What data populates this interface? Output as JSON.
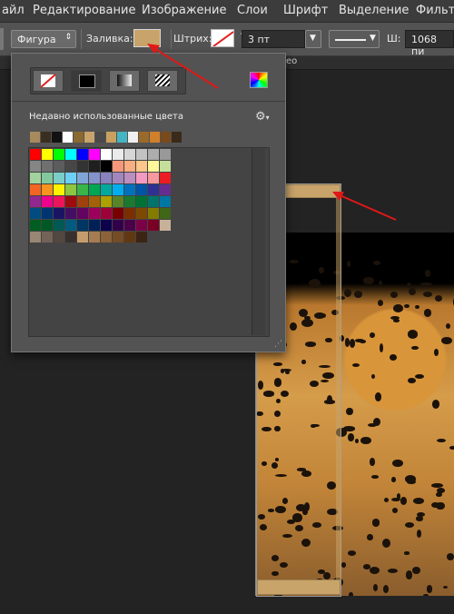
{
  "menubar": {
    "items": [
      "айл",
      "Редактирование",
      "Изображение",
      "Слои",
      "Шрифт",
      "Выделение",
      "Фильтр"
    ]
  },
  "options": {
    "shape_mode": "Фигура",
    "fill_label": "Заливка:",
    "stroke_label": "Штрих:",
    "stroke_width": "3 пт",
    "width_label": "Ш:",
    "width_value": "1068 пи",
    "fill_color": "#c8a46a"
  },
  "tab": {
    "label": "ео"
  },
  "picker": {
    "recent_title": "Недавно использованные цвета",
    "modes": [
      "no-fill",
      "solid",
      "gradient",
      "pattern"
    ],
    "recent_colors": [
      "#a88a5c",
      "#3a2e1e",
      "#111111",
      "#ffffff",
      "#8a6a30",
      "#c8a46a",
      "#4a4a4a",
      "#c8a060",
      "#43b5c2",
      "#f0f0f0",
      "#9a6a2a",
      "#d0802a",
      "#7a4a1a",
      "#3a2a1a"
    ],
    "swatches": [
      "#ff0000",
      "#ffff00",
      "#00ff00",
      "#00ffff",
      "#0000ff",
      "#ff00ff",
      "#ffffff",
      "#ebebeb",
      "#d6d6d6",
      "#c2c2c2",
      "#adadad",
      "#999999",
      "#858585",
      "#707070",
      "#5c5c5c",
      "#474747",
      "#333333",
      "#1f1f1f",
      "#000000",
      "#f7977a",
      "#f9ad81",
      "#fdc68a",
      "#fff79a",
      "#c4df9b",
      "#a2d39c",
      "#82ca9d",
      "#7bcdc8",
      "#6ecff6",
      "#7ea7d8",
      "#8493ca",
      "#8882be",
      "#a187be",
      "#bc8dbf",
      "#f49ac2",
      "#f6989d",
      "#ed1c24",
      "#f26522",
      "#f7941d",
      "#fff200",
      "#8dc63f",
      "#39b54a",
      "#00a651",
      "#00a99d",
      "#00aeef",
      "#0072bc",
      "#0054a6",
      "#2e3192",
      "#662d91",
      "#92278f",
      "#ec008c",
      "#ed145b",
      "#9e0b0f",
      "#a0410d",
      "#a36209",
      "#aba000",
      "#598527",
      "#1a7b30",
      "#007236",
      "#00746b",
      "#0076a3",
      "#004b80",
      "#003471",
      "#1b1464",
      "#440e62",
      "#630460",
      "#9e005d",
      "#9e0039",
      "#790000",
      "#7b2e00",
      "#7d4900",
      "#827b00",
      "#406618",
      "#005e20",
      "#005826",
      "#005952",
      "#005b7f",
      "#003663",
      "#002157",
      "#0d004c",
      "#32004b",
      "#4b0049",
      "#7b0046",
      "#7a0026",
      "#c7b299",
      "#998675",
      "#736357",
      "#534741",
      "#37302d",
      "#c69c6d",
      "#a67c52",
      "#8c6239",
      "#754c24",
      "#603913",
      "#3c2415"
    ]
  }
}
